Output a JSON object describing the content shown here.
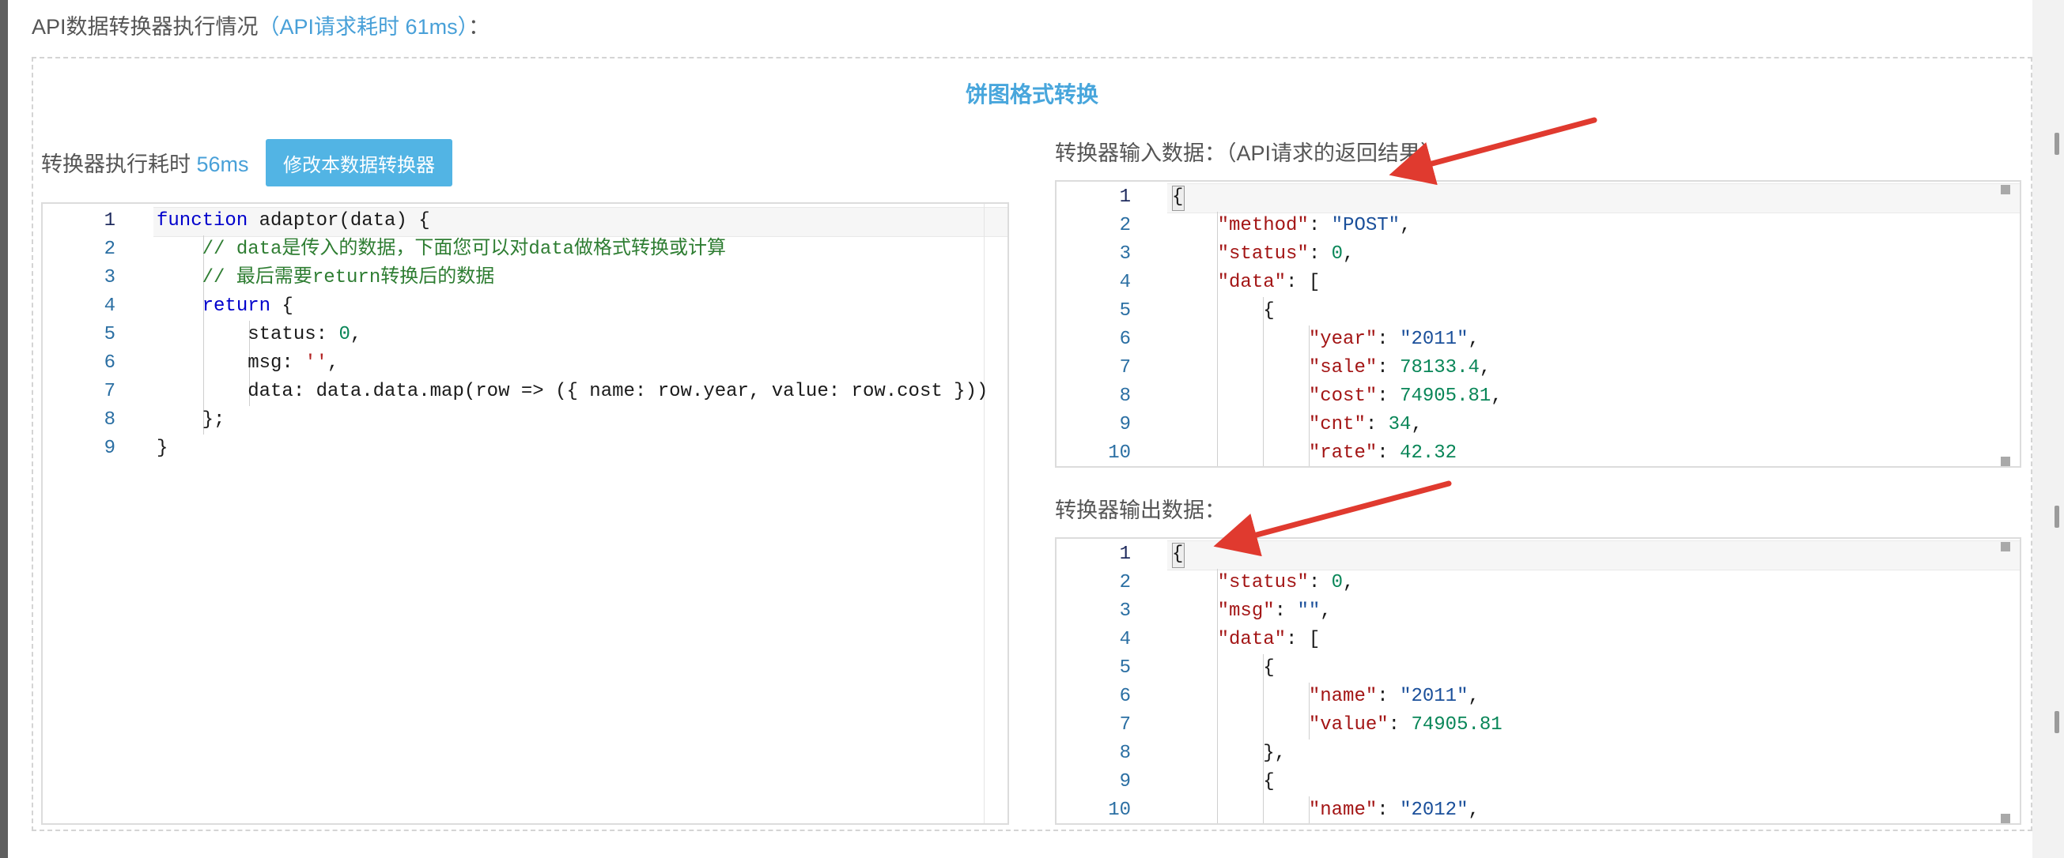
{
  "header": {
    "title": "API数据转换器执行情况",
    "timing": "（API请求耗时 61ms）",
    "suffix": "："
  },
  "panel": {
    "title": "饼图格式转换"
  },
  "converter": {
    "exec_label": "转换器执行耗时",
    "exec_time": "56ms",
    "edit_button": "修改本数据转换器"
  },
  "input_section": {
    "label": "转换器输入数据：（API请求的返回结果）"
  },
  "output_section": {
    "label": "转换器输出数据："
  },
  "editors": {
    "code": {
      "line_numbers": [
        "1",
        "2",
        "3",
        "4",
        "5",
        "6",
        "7",
        "8",
        "9"
      ],
      "lines": [
        "function adaptor(data) {",
        "    // data是传入的数据，下面您可以对data做格式转换或计算",
        "    // 最后需要return转换后的数据",
        "    return {",
        "        status: 0,",
        "        msg: '',",
        "        data: data.data.map(row => ({ name: row.year, value: row.cost }))",
        "    };",
        "}"
      ]
    },
    "input": {
      "line_numbers": [
        "1",
        "2",
        "3",
        "4",
        "5",
        "6",
        "7",
        "8",
        "9",
        "10"
      ],
      "lines": [
        "{",
        "    \"method\": \"POST\",",
        "    \"status\": 0,",
        "    \"data\": [",
        "        {",
        "            \"year\": \"2011\",",
        "            \"sale\": 78133.4,",
        "            \"cost\": 74905.81,",
        "            \"cnt\": 34,",
        "            \"rate\": 42.32"
      ]
    },
    "output": {
      "line_numbers": [
        "1",
        "2",
        "3",
        "4",
        "5",
        "6",
        "7",
        "8",
        "9",
        "10"
      ],
      "lines": [
        "{",
        "    \"status\": 0,",
        "    \"msg\": \"\",",
        "    \"data\": [",
        "        {",
        "            \"name\": \"2011\",",
        "            \"value\": 74905.81",
        "        },",
        "        {",
        "            \"name\": \"2012\","
      ]
    }
  },
  "colors": {
    "accent": "#48a0d8",
    "button": "#52b4e4",
    "arrow": "#e03a2f"
  },
  "icons": {
    "arrow": "red-annotation-arrow"
  }
}
